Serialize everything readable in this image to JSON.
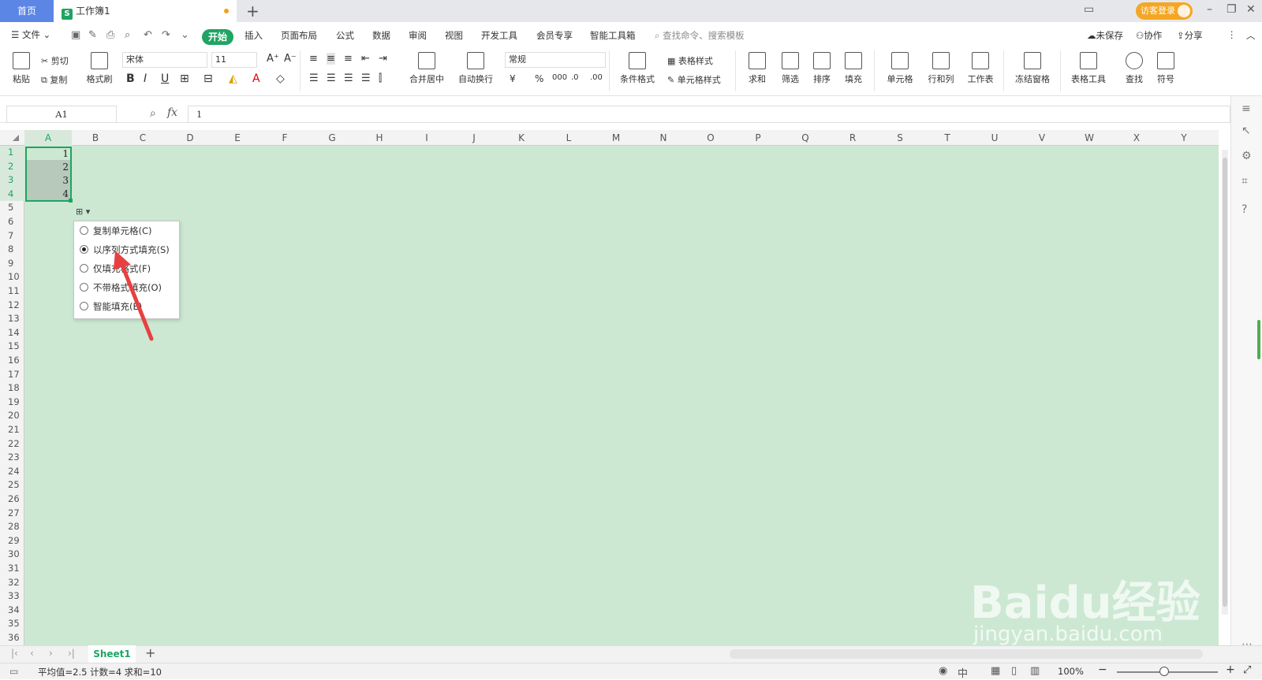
{
  "titlebar": {
    "home_tab": "首页",
    "doc_tab": "工作簿1",
    "doc_icon": "S",
    "login": "访客登录"
  },
  "menu": {
    "file": "文件",
    "start": "开始",
    "items": [
      "插入",
      "页面布局",
      "公式",
      "数据",
      "审阅",
      "视图",
      "开发工具",
      "会员专享",
      "智能工具箱"
    ],
    "search_placeholder": "查找命令、搜索模板",
    "unsaved": "未保存",
    "collab": "协作",
    "share": "分享"
  },
  "ribbon": {
    "paste": "粘贴",
    "cut": "剪切",
    "copy": "复制",
    "format_painter": "格式刷",
    "font": "宋体",
    "font_size": "11",
    "merge_center": "合并居中",
    "wrap": "自动换行",
    "number_format": "常规",
    "cond_format": "条件格式",
    "table_style": "表格样式",
    "cell_style": "单元格样式",
    "sum": "求和",
    "filter": "筛选",
    "sort": "排序",
    "fill": "填充",
    "cells": "单元格",
    "rows_cols": "行和列",
    "worksheet": "工作表",
    "freeze": "冻结窗格",
    "table_tools": "表格工具",
    "find": "查找",
    "symbol": "符号"
  },
  "formula_bar": {
    "name_box": "A1",
    "fx": "fx",
    "value": "1"
  },
  "columns": [
    "A",
    "B",
    "C",
    "D",
    "E",
    "F",
    "G",
    "H",
    "I",
    "J",
    "K",
    "L",
    "M",
    "N",
    "O",
    "P",
    "Q",
    "R",
    "S",
    "T",
    "U",
    "V",
    "W",
    "X",
    "Y"
  ],
  "rows": [
    "1",
    "2",
    "3",
    "4",
    "5",
    "6",
    "7",
    "8",
    "9",
    "10",
    "11",
    "12",
    "13",
    "14",
    "15",
    "16",
    "17",
    "18",
    "19",
    "20",
    "21",
    "22",
    "23",
    "24",
    "25",
    "26",
    "27",
    "28",
    "29",
    "30",
    "31",
    "32",
    "33",
    "34",
    "35",
    "36"
  ],
  "cells": {
    "A1": "1",
    "A2": "2",
    "A3": "3",
    "A4": "4"
  },
  "autofill_menu": {
    "options": [
      {
        "label": "复制单元格(C)",
        "selected": false
      },
      {
        "label": "以序列方式填充(S)",
        "selected": true
      },
      {
        "label": "仅填充格式(F)",
        "selected": false
      },
      {
        "label": "不带格式填充(O)",
        "selected": false
      },
      {
        "label": "智能填充(E)",
        "selected": false
      }
    ]
  },
  "sheet_tabs": {
    "active": "Sheet1"
  },
  "status": {
    "summary": "平均值=2.5  计数=4  求和=10",
    "zoom": "100%"
  },
  "watermark": {
    "logo": "Baidu经验",
    "url": "jingyan.baidu.com"
  },
  "colors": {
    "accent": "#1fa463",
    "sheet_bg": "#cce8d2",
    "home_tab": "#5b86e5",
    "login": "#f5a623",
    "arrow": "#e84040"
  }
}
